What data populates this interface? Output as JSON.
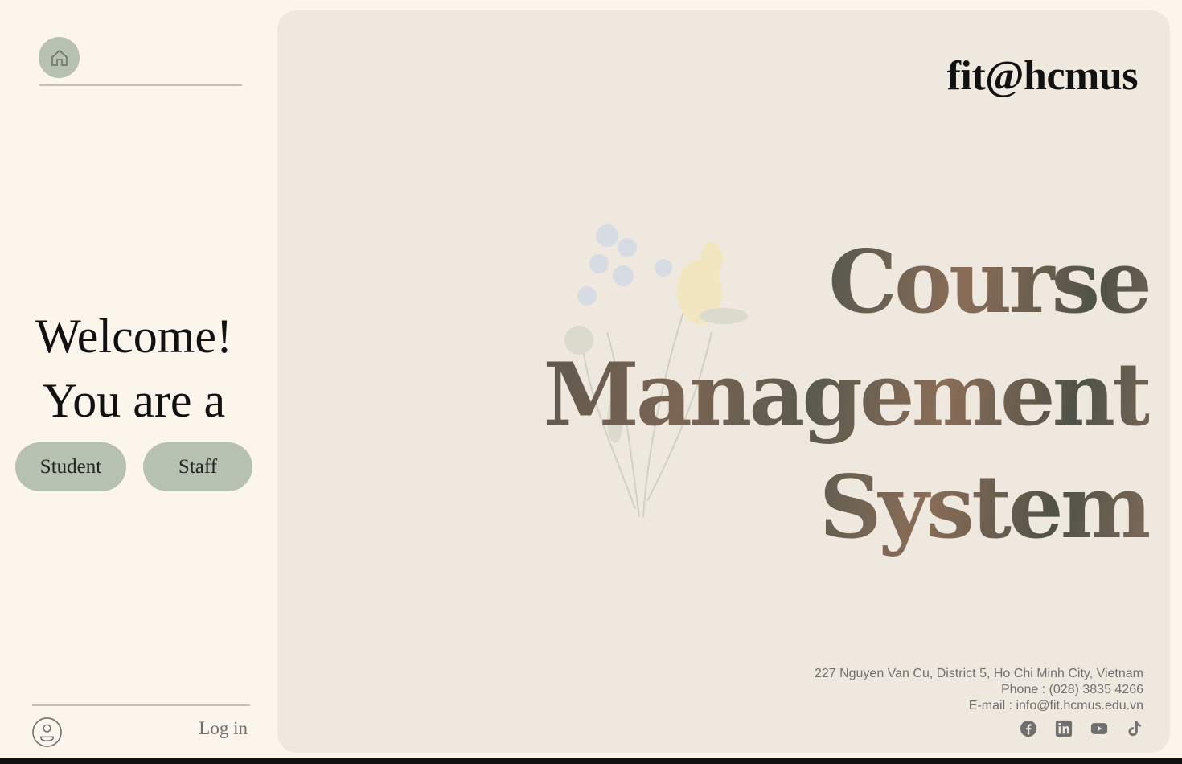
{
  "sidebar": {
    "welcome_line1": "Welcome!",
    "welcome_line2": "You are a",
    "roles": {
      "student_label": "Student",
      "staff_label": "Staff"
    },
    "login_label": "Log in",
    "icons": {
      "home": "home-icon",
      "user": "user-circle-icon"
    }
  },
  "main": {
    "brand": "fit@hcmus",
    "hero": {
      "line1": "Course",
      "line2": "Management",
      "line3": "System"
    },
    "contact": {
      "address": "227 Nguyen Van Cu, District 5, Ho Chi Minh City, Vietnam",
      "phone": "Phone : (028) 3835 4266",
      "email": "E-mail : info@fit.hcmus.edu.vn"
    },
    "socials": [
      "facebook-icon",
      "linkedin-icon",
      "youtube-icon",
      "tiktok-icon"
    ]
  },
  "colors": {
    "page_bg": "#fbf5ec",
    "panel_bg": "#efe8de",
    "button_bg": "#b6c1b2",
    "divider": "#c8c0b4",
    "muted_text": "#707070"
  }
}
